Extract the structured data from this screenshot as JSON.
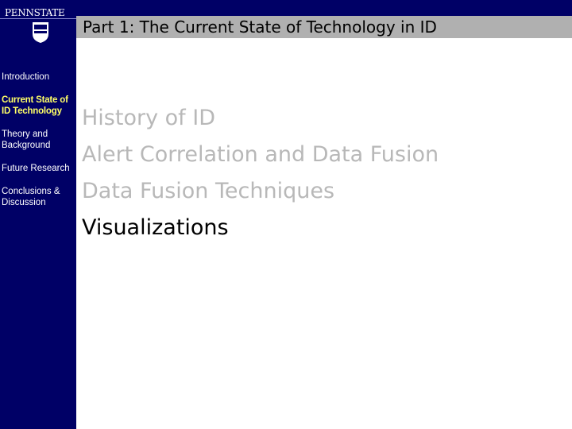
{
  "logo": {
    "text": "PENNSTATE",
    "icon": "penn-state-shield-icon"
  },
  "header": {
    "title": "Part 1: The Current State of Technology in ID"
  },
  "sidebar": {
    "items": [
      {
        "label": "Introduction",
        "active": false
      },
      {
        "label": "Current State of ID Technology",
        "active": true
      },
      {
        "label": "Theory and Background",
        "active": false
      },
      {
        "label": "Future Research",
        "active": false
      },
      {
        "label": "Conclusions & Discussion",
        "active": false
      }
    ]
  },
  "main": {
    "bullets": [
      {
        "text": "History of ID",
        "current": false
      },
      {
        "text": "Alert Correlation and Data Fusion",
        "current": false
      },
      {
        "text": "Data Fusion Techniques",
        "current": false
      },
      {
        "text": "Visualizations",
        "current": true
      }
    ]
  },
  "colors": {
    "navy": "#000066",
    "title_bar": "#b0b0b0",
    "active_nav": "#ffff66",
    "inactive_bullet": "#b8b8b8",
    "current_bullet": "#000000"
  }
}
